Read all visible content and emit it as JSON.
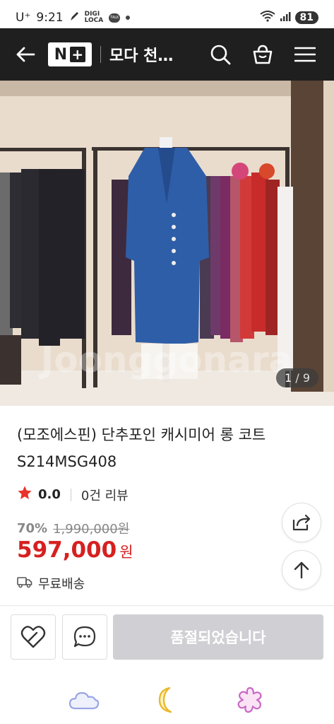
{
  "status_bar": {
    "carrier": "U⁺",
    "time": "9:21",
    "mini_label": "DIGI\nLOCA",
    "talk_label": "TALK",
    "battery": "81"
  },
  "app_bar": {
    "logo_letter": "N",
    "logo_plus": "+",
    "store_title": "모다 천…"
  },
  "product": {
    "image_counter_current": "1",
    "image_counter_total": " / 9",
    "title": "(모조에스핀) 단추포인 캐시미어 롱 코트 S214MSG408",
    "rating_score": "0.0",
    "review_count": "0건 리뷰",
    "discount": "70%",
    "original_price": "1,990,000원",
    "price": "597,000",
    "price_unit": "원",
    "shipping": "무료배송"
  },
  "actions": {
    "soldout_label": "품절되었습니다"
  },
  "colors": {
    "app_bar_bg": "#1f1f1f",
    "price_red": "#d62020",
    "star": "#e8322a",
    "soldout_bg": "#cfcfd4"
  }
}
